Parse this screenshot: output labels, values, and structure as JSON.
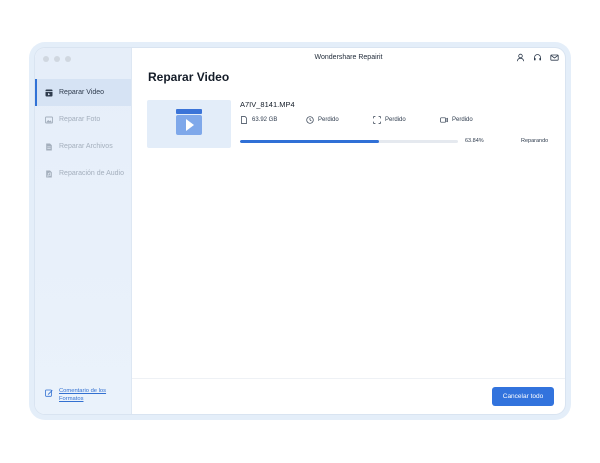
{
  "app": {
    "title": "Wondershare Repairit"
  },
  "sidebar": {
    "items": [
      {
        "label": "Reparar Video",
        "active": true,
        "icon": "video-repair-icon"
      },
      {
        "label": "Reparar Foto",
        "active": false,
        "icon": "photo-repair-icon"
      },
      {
        "label": "Reparar Archivos",
        "active": false,
        "icon": "file-repair-icon"
      },
      {
        "label": "Reparación de Audio",
        "active": false,
        "icon": "audio-repair-icon"
      }
    ],
    "feedback_label": "Comentario de los Formatos"
  },
  "header": {
    "icons": [
      "user-icon",
      "headset-icon",
      "mail-icon"
    ]
  },
  "main": {
    "title": "Reparar Video",
    "file": {
      "name": "A7IV_8141.MP4",
      "size": "63.92 GB",
      "duration": "Perdido",
      "resolution": "Perdido",
      "camera": "Perdido",
      "progress_percent": 63.84,
      "progress_label": "63.84%",
      "status": "Reparando"
    }
  },
  "footer": {
    "cancel_all_label": "Cancelar todo"
  },
  "colors": {
    "accent": "#3273dd",
    "sidebar_bg": "#e6eef9",
    "thumb_bg": "#e3edf9"
  }
}
